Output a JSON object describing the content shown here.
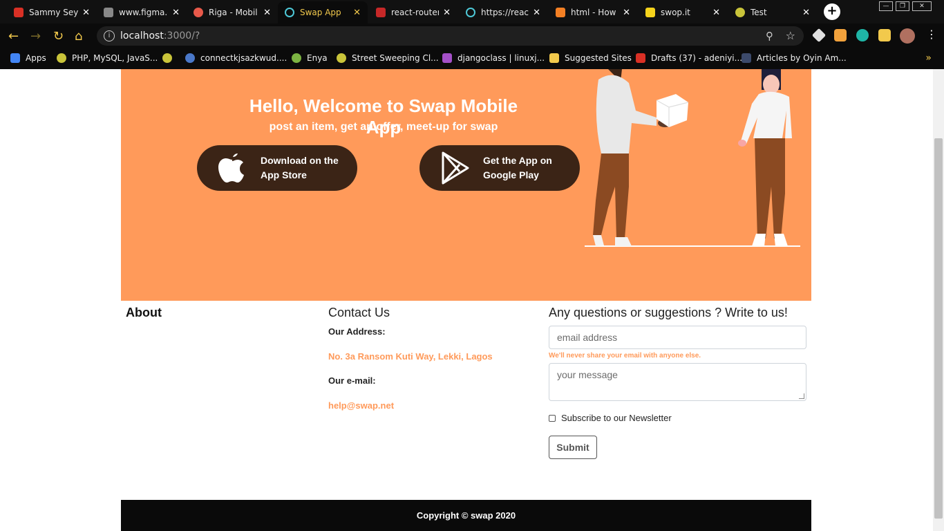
{
  "browser": {
    "tabs": [
      {
        "title": "Sammy Seyi",
        "color": "#d93025"
      },
      {
        "title": "www.figma.c",
        "color": "#888888"
      },
      {
        "title": "Riga - Mobil",
        "color": "#e8594a"
      },
      {
        "title": "Swap App",
        "color": "#4ec9d8",
        "active": true
      },
      {
        "title": "react-router",
        "color": "#c62828"
      },
      {
        "title": "https://reac",
        "color": "#4ec9d8"
      },
      {
        "title": "html - How",
        "color": "#f48024"
      },
      {
        "title": "swop.it",
        "color": "#f5d31c"
      },
      {
        "title": "Test",
        "color": "#c9c43a"
      }
    ],
    "tab_close": "✕",
    "new_tab": "+",
    "url_host": "localhost",
    "url_path": ":3000/?",
    "bookmarks": [
      {
        "label": "Apps",
        "color": "#4285f4"
      },
      {
        "label": "PHP, MySQL, JavaS...",
        "color": "#c9c43a"
      },
      {
        "label": "",
        "color": "#c9c43a"
      },
      {
        "label": "connectkjsazkwud....",
        "color": "#4a78c9"
      },
      {
        "label": "Enya",
        "color": "#7cb342"
      },
      {
        "label": "Street Sweeping Cl...",
        "color": "#c9c43a"
      },
      {
        "label": "djangoclass | linuxj...",
        "color": "#a450c8"
      },
      {
        "label": "Suggested Sites",
        "color": "#f2c94c"
      },
      {
        "label": "Drafts (37) - adeniyi...",
        "color": "#d93025"
      },
      {
        "label": "Articles by Oyin Am...",
        "color": "#3c4a6b"
      }
    ],
    "bookmarks_more": "»"
  },
  "hero": {
    "title": "Hello, Welcome to Swap Mobile App",
    "subtitle": "post an item, get an offer, meet-up for swap",
    "app_store_line1": "Download on the",
    "app_store_line2": "App Store",
    "google_play_line1": "Get the App on",
    "google_play_line2": "Google Play",
    "bg_color": "#ff9a5a",
    "button_color": "#3b2416"
  },
  "about": {
    "title": "About"
  },
  "contact": {
    "title": "Contact Us",
    "address_label": "Our Address:",
    "address": "No. 3a Ransom Kuti Way, Lekki, Lagos",
    "email_label": "Our e-mail:",
    "email": "help@swap.net"
  },
  "form": {
    "title": "Any questions or suggestions ? Write to us!",
    "email_placeholder": "email address",
    "email_help": "We'll never share your email with anyone else.",
    "message_placeholder": "your message",
    "newsletter_label": "Subscribe to our Newsletter",
    "submit_label": "Submit"
  },
  "footer": {
    "copyright": "Copyright © swap 2020"
  }
}
